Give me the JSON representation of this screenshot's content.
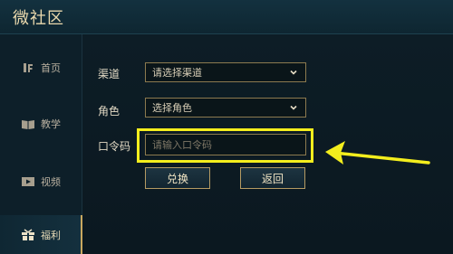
{
  "header": {
    "title": "微社区"
  },
  "sidebar": {
    "items": [
      {
        "label": "首页",
        "icon": "home-icon"
      },
      {
        "label": "教学",
        "icon": "book-icon"
      },
      {
        "label": "视频",
        "icon": "video-icon"
      },
      {
        "label": "福利",
        "icon": "gift-icon"
      }
    ],
    "active": "福利"
  },
  "form": {
    "channel": {
      "label": "渠道",
      "value": "请选择渠道"
    },
    "role": {
      "label": "角色",
      "value": "选择角色"
    },
    "code": {
      "label": "口令码",
      "placeholder": "请输入口令码"
    }
  },
  "buttons": {
    "redeem": "兑换",
    "back": "返回"
  },
  "colors": {
    "accent_gold": "#b59b63",
    "highlight_yellow": "#f4ee1d",
    "background": "#0b1a22"
  }
}
